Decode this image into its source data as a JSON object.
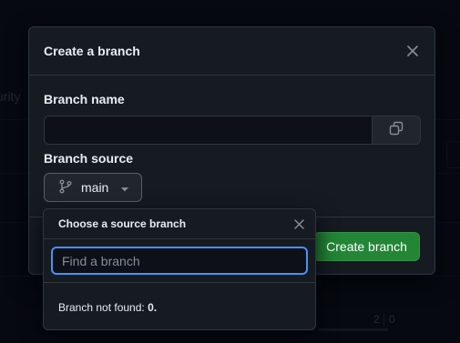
{
  "background": {
    "partial_text": "urity",
    "count_a": "2",
    "count_b": "0"
  },
  "dialog": {
    "title": "Create a branch",
    "close_icon": "close-icon",
    "branch_name_label": "Branch name",
    "branch_name_value": "",
    "copy_icon": "copy-icon",
    "branch_source_label": "Branch source",
    "source_button": {
      "icon": "git-branch-icon",
      "label": "main",
      "caret": "triangle-down-icon"
    },
    "create_button_label": "Create branch",
    "create_button_color": "#238636"
  },
  "popover": {
    "title": "Choose a source branch",
    "close_icon": "close-icon",
    "filter_placeholder": "Find a branch",
    "filter_value": "",
    "empty_prefix": "Branch not found:",
    "empty_query": "0."
  },
  "colors": {
    "focus_ring": "#4493f8",
    "surface": "#161b22",
    "border": "#30363d"
  }
}
